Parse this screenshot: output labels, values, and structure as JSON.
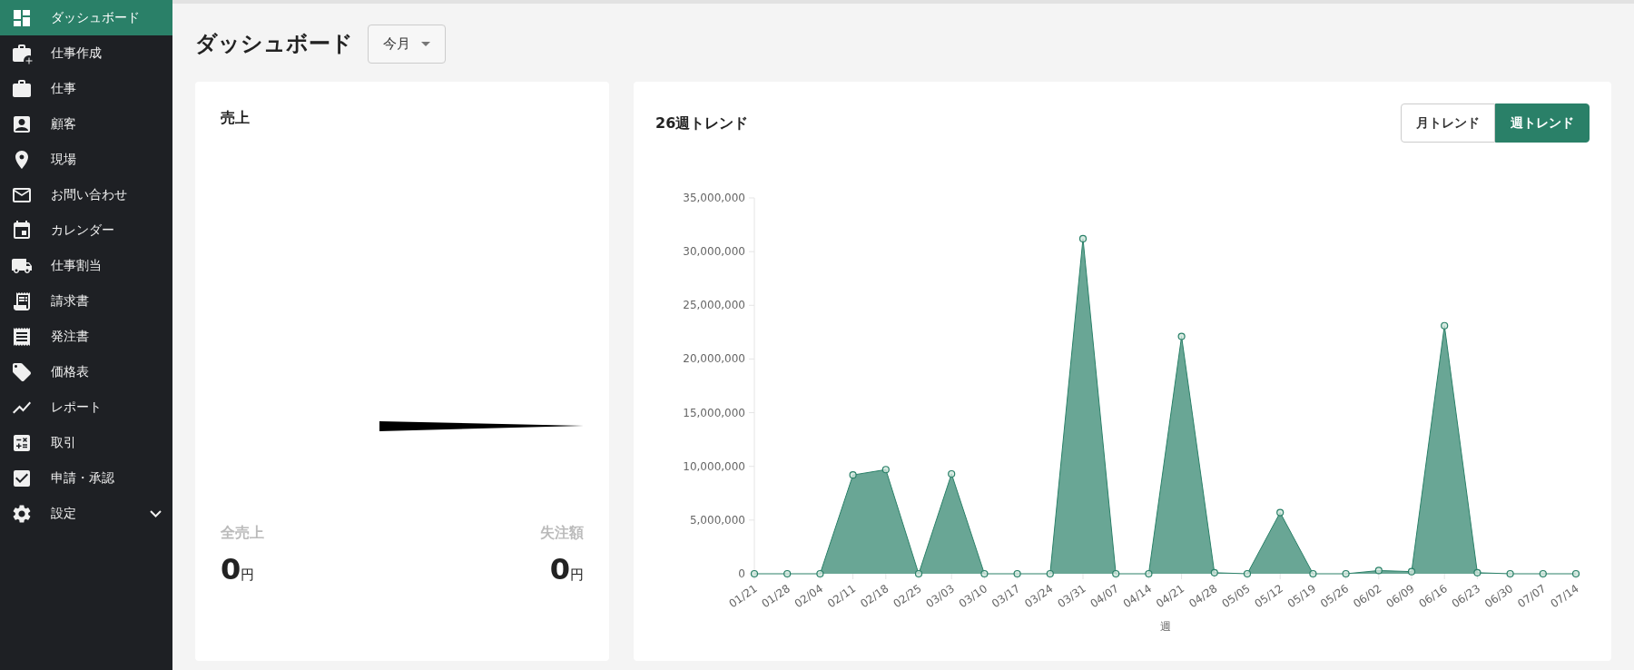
{
  "sidebar": {
    "items": [
      {
        "label": "ダッシュボード",
        "selected": true,
        "kind": "link"
      },
      {
        "label": "仕事作成",
        "selected": false,
        "kind": "link"
      },
      {
        "label": "仕事",
        "selected": false,
        "kind": "link"
      },
      {
        "label": "顧客",
        "selected": false,
        "kind": "link"
      },
      {
        "label": "現場",
        "selected": false,
        "kind": "link"
      },
      {
        "label": "お問い合わせ",
        "selected": false,
        "kind": "link"
      },
      {
        "label": "カレンダー",
        "selected": false,
        "kind": "link"
      },
      {
        "label": "仕事割当",
        "selected": false,
        "kind": "link"
      },
      {
        "label": "請求書",
        "selected": false,
        "kind": "link"
      },
      {
        "label": "発注書",
        "selected": false,
        "kind": "link"
      },
      {
        "label": "価格表",
        "selected": false,
        "kind": "link"
      },
      {
        "label": "レポート",
        "selected": false,
        "kind": "link"
      },
      {
        "label": "取引",
        "selected": false,
        "kind": "link"
      },
      {
        "label": "申請・承認",
        "selected": false,
        "kind": "link"
      },
      {
        "label": "設定",
        "selected": false,
        "kind": "group",
        "expanded": false
      }
    ]
  },
  "header": {
    "title": "ダッシュボード",
    "period": "今月"
  },
  "sales_card": {
    "title": "売上",
    "stats": [
      {
        "label": "全売上",
        "value": "0",
        "unit": "円"
      },
      {
        "label": "失注額",
        "value": "0",
        "unit": "円"
      }
    ]
  },
  "trend_card": {
    "title": "26週トレンド",
    "toggle": [
      {
        "label": "月トレンド",
        "selected": false
      },
      {
        "label": "週トレンド",
        "selected": true
      }
    ],
    "chart_data": {
      "type": "area",
      "xlabel": "週",
      "categories": [
        "01/21",
        "01/28",
        "02/04",
        "02/11",
        "02/18",
        "02/25",
        "03/03",
        "03/10",
        "03/17",
        "03/24",
        "03/31",
        "04/07",
        "04/14",
        "04/21",
        "04/28",
        "05/05",
        "05/12",
        "05/19",
        "05/26",
        "06/02",
        "06/09",
        "06/16",
        "06/23",
        "06/30",
        "07/07",
        "07/14"
      ],
      "series": [
        {
          "color": "#2a8068",
          "values": [
            0,
            0,
            0,
            9200000,
            9700000,
            0,
            9300000,
            0,
            0,
            0,
            31200000,
            0,
            0,
            22100000,
            100000,
            0,
            5700000,
            0,
            0,
            300000,
            200000,
            23100000,
            100000,
            0,
            0,
            0
          ]
        }
      ],
      "ylim": [
        0,
        35000000
      ],
      "yticks": [
        {
          "value": 0,
          "label": "0"
        },
        {
          "value": 5000000,
          "label": "5,000,000"
        },
        {
          "value": 10000000,
          "label": "10,000,000"
        },
        {
          "value": 15000000,
          "label": "15,000,000"
        },
        {
          "value": 20000000,
          "label": "20,000,000"
        },
        {
          "value": 25000000,
          "label": "25,000,000"
        },
        {
          "value": 30000000,
          "label": "30,000,000"
        },
        {
          "value": 35000000,
          "label": "35,000,000"
        }
      ]
    }
  }
}
